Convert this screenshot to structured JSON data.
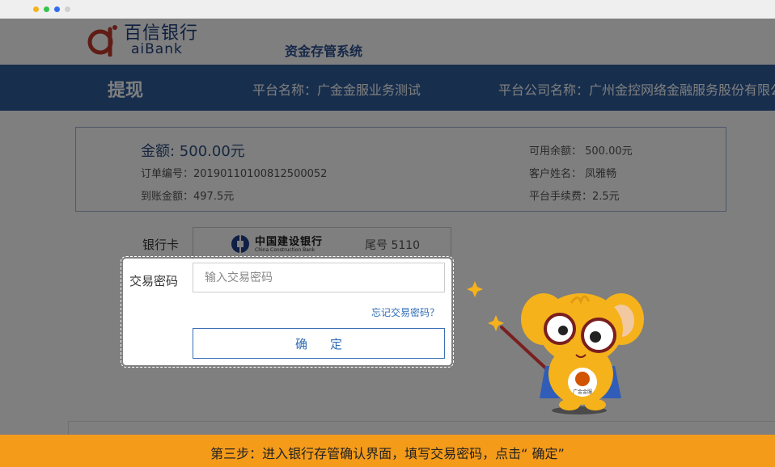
{
  "header": {
    "logo_cn": "百信银行",
    "logo_en": "aiBank",
    "system_title": "资金存管系统"
  },
  "nav": {
    "title": "提现",
    "platform_name": "平台名称：广金金服业务测试",
    "company_name": "平台公司名称：广州金控网络金融服务股份有限公司"
  },
  "order": {
    "amount": "金额: 500.00元",
    "order_no": "订单编号：20190110100812500052",
    "arrival": "到账金额：497.5元",
    "available": "可用余额： 500.00元",
    "customer": "客户姓名： 凤雅畅",
    "fee": "平台手续费：2.5元"
  },
  "bank": {
    "label": "银行卡",
    "bank_cn": "中国建设银行",
    "bank_en": "China Construction Bank",
    "tail": "尾号 5110"
  },
  "dialog": {
    "password_label": "交易密码",
    "password_placeholder": "输入交易密码",
    "forgot_link": "忘记交易密码？",
    "confirm_label": "确定"
  },
  "mascot": {
    "badge_text": "广金金服"
  },
  "banner": {
    "text": "第三步：进入银行存管确认界面，填写交易密码，点击“ 确定”"
  },
  "colors": {
    "nav_bg": "#2e5c9a",
    "logo_red": "#c0392b",
    "banner_bg": "#f49b1a",
    "link_blue": "#2f6cb5"
  },
  "icons": {
    "window_dots": [
      "window-dot-yellow-icon",
      "window-dot-green-icon",
      "window-dot-blue-icon",
      "window-dot-grey-icon"
    ],
    "bank_logo": "ccb-logo-icon",
    "mascot": "elephant-mascot-icon"
  }
}
